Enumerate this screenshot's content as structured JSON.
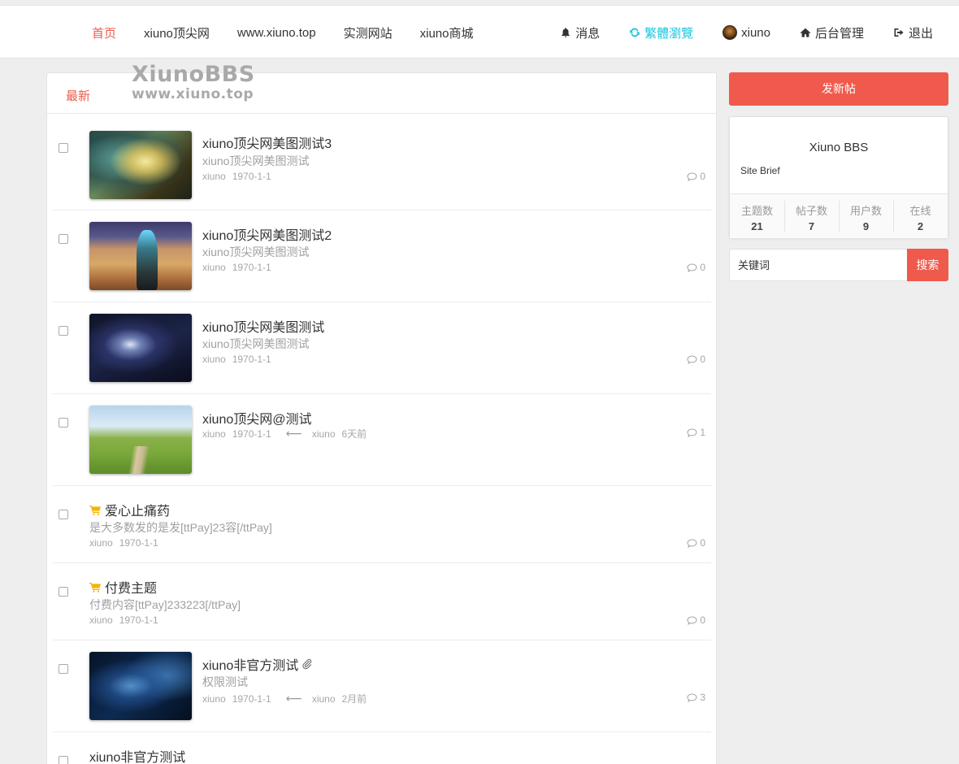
{
  "nav": {
    "left": [
      {
        "label": "首页",
        "active": true
      },
      {
        "label": "xiuno顶尖网"
      },
      {
        "label": "www.xiuno.top"
      },
      {
        "label": "实测网站"
      },
      {
        "label": "xiuno商城"
      }
    ],
    "right": {
      "messages": "消息",
      "traditional": "繁體瀏覽",
      "user": "xiuno",
      "admin": "后台管理",
      "logout": "退出"
    }
  },
  "watermark": {
    "line1": "XiunoBBS",
    "line2": "www.xiuno.top"
  },
  "tabs": {
    "latest": "最新"
  },
  "threads": [
    {
      "title": "xiuno顶尖网美图测试3",
      "brief": "xiuno顶尖网美图测试",
      "author": "xiuno",
      "date": "1970-1-1",
      "replies": "0"
    },
    {
      "title": "xiuno顶尖网美图测试2",
      "brief": "xiuno顶尖网美图测试",
      "author": "xiuno",
      "date": "1970-1-1",
      "replies": "0"
    },
    {
      "title": "xiuno顶尖网美图测试",
      "brief": "xiuno顶尖网美图测试",
      "author": "xiuno",
      "date": "1970-1-1",
      "replies": "0"
    },
    {
      "title": "xiuno顶尖网@测试",
      "author": "xiuno",
      "date": "1970-1-1",
      "last_user": "xiuno",
      "last_time": "6天前",
      "replies": "1"
    },
    {
      "title": "爱心止痛药",
      "brief": "是大多数发的是发[ttPay]23容[/ttPay]",
      "author": "xiuno",
      "date": "1970-1-1",
      "replies": "0"
    },
    {
      "title": "付费主题",
      "brief": "付费内容[ttPay]233223[/ttPay]",
      "author": "xiuno",
      "date": "1970-1-1",
      "replies": "0"
    },
    {
      "title": "xiuno非官方测试",
      "brief": "权限测试",
      "author": "xiuno",
      "date": "1970-1-1",
      "last_user": "xiuno",
      "last_time": "2月前",
      "replies": "3"
    },
    {
      "title": "xiuno非官方测试"
    }
  ],
  "sidebar": {
    "new_post": "发新帖",
    "site_name": "Xiuno BBS",
    "site_brief": "Site Brief",
    "stats": [
      {
        "label": "主题数",
        "value": "21"
      },
      {
        "label": "帖子数",
        "value": "7"
      },
      {
        "label": "用户数",
        "value": "9"
      },
      {
        "label": "在线",
        "value": "2"
      }
    ],
    "search_placeholder": "关键词",
    "search_button": "搜索"
  },
  "colors": {
    "accent": "#f05a4c",
    "nav_active": "#ee5a4a",
    "cyan": "#19c7de",
    "cart": "#f5b400"
  }
}
